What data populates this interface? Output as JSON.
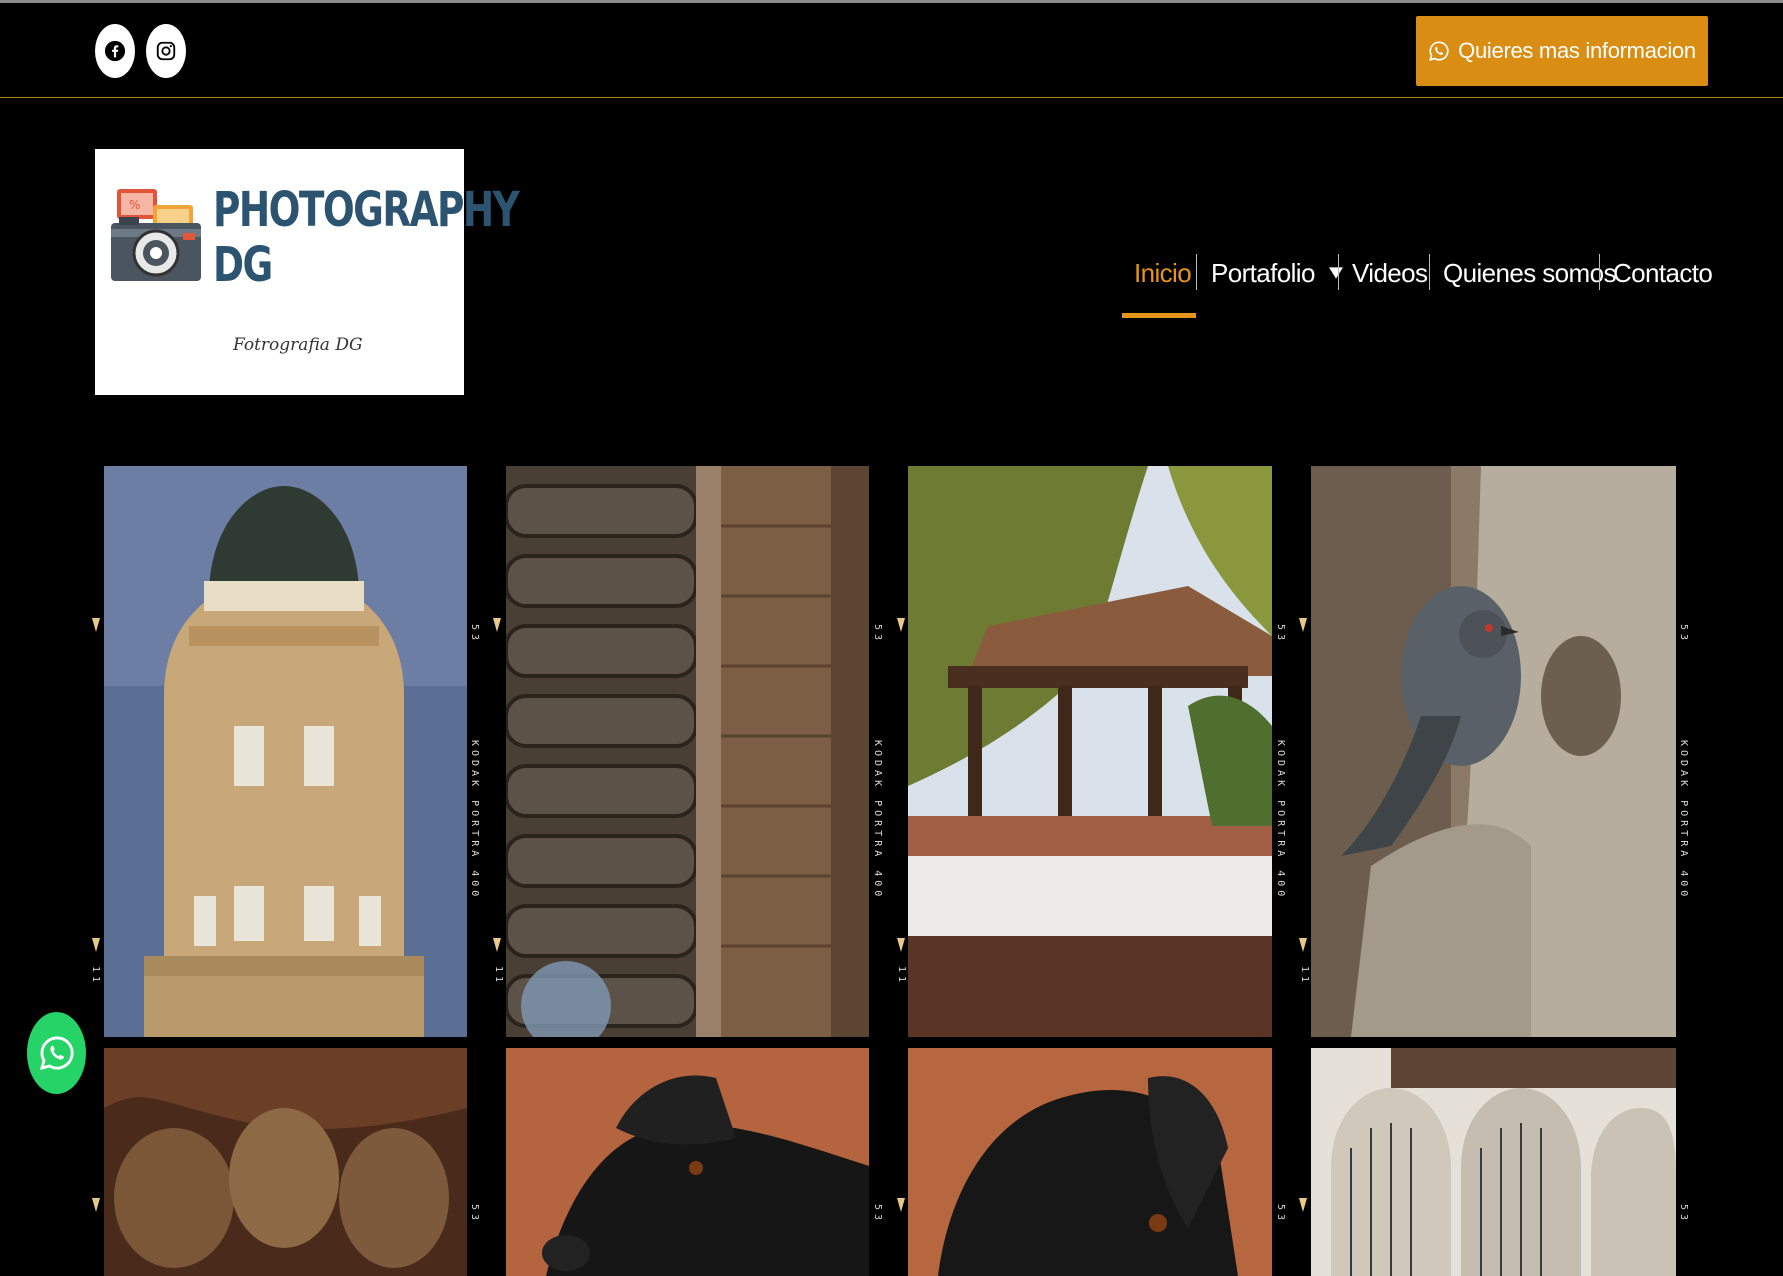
{
  "topbar": {
    "social": [
      {
        "name": "facebook-icon"
      },
      {
        "name": "instagram-icon"
      }
    ],
    "cta_label": "Quieres mas informacion"
  },
  "logo": {
    "title_line1": "PHOTOGRAPHY",
    "title_line2": "DG",
    "subtitle": "Fotrografia DG"
  },
  "nav": {
    "items": [
      {
        "label": "Inicio",
        "active": true
      },
      {
        "label": "Portafolio",
        "has_dropdown": true
      },
      {
        "label": "Videos"
      },
      {
        "label": "Quienes somos"
      },
      {
        "label": "Contacto"
      }
    ]
  },
  "gallery": {
    "film_label": "KODAK PORTRA 400",
    "frame_top": "53",
    "frame_bottom": "11",
    "photos": [
      {
        "subject": "domed-building"
      },
      {
        "subject": "wooden-door"
      },
      {
        "subject": "wooden-pergola-with-willow"
      },
      {
        "subject": "pigeon-on-tree"
      },
      {
        "subject": "hands-with-potatoes"
      },
      {
        "subject": "black-dog-on-wood"
      },
      {
        "subject": "black-dog-closeup"
      },
      {
        "subject": "white-arches"
      }
    ]
  },
  "colors": {
    "accent": "#e7941a",
    "cta": "#d98d12",
    "whatsapp": "#25d366",
    "logo_text": "#2c5470"
  }
}
